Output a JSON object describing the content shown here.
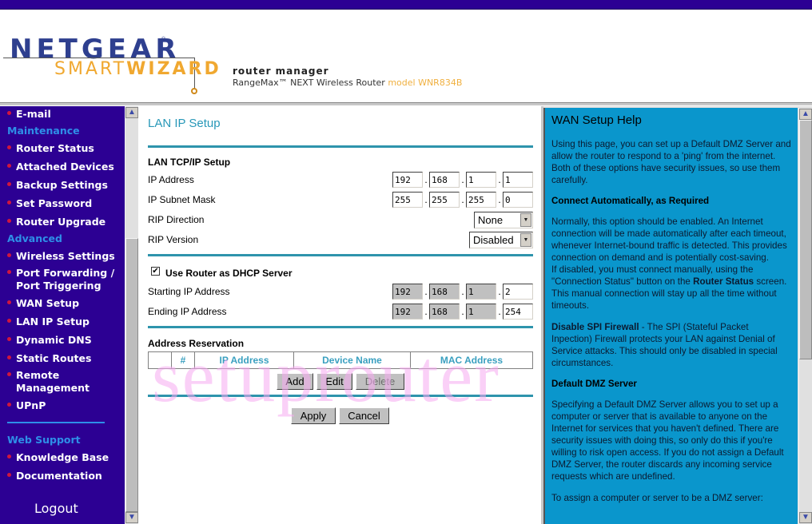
{
  "header": {
    "brand": "NETGEAR",
    "smart": "SMART",
    "wizard": "WIZARD",
    "router_manager": "router manager",
    "product": "RangeMax™ NEXT Wireless Router",
    "model": "model WNR834B"
  },
  "sidebar": {
    "items": [
      {
        "label": "E-mail",
        "type": "link"
      },
      {
        "label": "Maintenance",
        "type": "heading"
      },
      {
        "label": "Router Status",
        "type": "link"
      },
      {
        "label": "Attached Devices",
        "type": "link"
      },
      {
        "label": "Backup Settings",
        "type": "link"
      },
      {
        "label": "Set Password",
        "type": "link"
      },
      {
        "label": "Router Upgrade",
        "type": "link"
      },
      {
        "label": "Advanced",
        "type": "heading"
      },
      {
        "label": "Wireless Settings",
        "type": "link"
      },
      {
        "label": "Port Forwarding /",
        "label2": "Port Triggering",
        "type": "link"
      },
      {
        "label": "WAN Setup",
        "type": "link"
      },
      {
        "label": "LAN IP Setup",
        "type": "link"
      },
      {
        "label": "Dynamic DNS",
        "type": "link"
      },
      {
        "label": "Static Routes",
        "type": "link"
      },
      {
        "label": "Remote",
        "label2": "Management",
        "type": "link"
      },
      {
        "label": "UPnP",
        "type": "link"
      },
      {
        "label": "Web Support",
        "type": "heading"
      },
      {
        "label": "Knowledge Base",
        "type": "link"
      },
      {
        "label": "Documentation",
        "type": "link"
      }
    ],
    "logout": "Logout"
  },
  "main": {
    "title": "LAN IP Setup",
    "tcpip": {
      "heading": "LAN TCP/IP Setup",
      "ip_address": {
        "label": "IP Address",
        "octets": [
          "192",
          "168",
          "1",
          "1"
        ]
      },
      "subnet_mask": {
        "label": "IP Subnet Mask",
        "octets": [
          "255",
          "255",
          "255",
          "0"
        ]
      },
      "rip_direction": {
        "label": "RIP Direction",
        "value": "None"
      },
      "rip_version": {
        "label": "RIP Version",
        "value": "Disabled"
      }
    },
    "dhcp": {
      "checkbox_label": "Use Router as DHCP Server",
      "checked": true,
      "checkmark": "✔",
      "start": {
        "label": "Starting IP Address",
        "octets": [
          "192",
          "168",
          "1",
          "2"
        ]
      },
      "end": {
        "label": "Ending IP Address",
        "octets": [
          "192",
          "168",
          "1",
          "254"
        ]
      }
    },
    "reservation": {
      "heading": "Address Reservation",
      "columns": [
        "",
        "#",
        "IP Address",
        "Device Name",
        "MAC Address"
      ],
      "rows": [],
      "add": "Add",
      "edit": "Edit",
      "delete": "Delete"
    },
    "apply": "Apply",
    "cancel": "Cancel",
    "ip_separator": "."
  },
  "help": {
    "title": "WAN Setup Help",
    "intro": "Using this page, you can set up a Default DMZ Server and allow the router to respond to a 'ping' from the internet. Both of these options have security issues, so use them carefully.",
    "connect_heading": "Connect Automatically, as Required",
    "connect_p1": "Normally, this option should be enabled. An Internet connection will be made automatically after each timeout, whenever Internet-bound traffic is detected. This provides connection on demand and is potentially cost-saving.",
    "connect_p2a": "If disabled, you must connect manually, using the \"Connection Status\" button on the ",
    "connect_p2b": "Router Status",
    "connect_p2c": " screen. This manual connection will stay up all the time without timeouts.",
    "spi_heading": "Disable SPI Firewall",
    "spi_text": " - The SPI (Stateful Packet Inpection) Firewall protects your LAN against Denial of Service attacks. This should only be disabled in special circumstances.",
    "dmz_heading": "Default DMZ Server",
    "dmz_p1": "Specifying a Default DMZ Server allows you to set up a computer or server that is available to anyone on the Internet for services that you haven't defined. There are security issues with doing this, so only do this if you're willing to risk open access. If you do not assign a Default DMZ Server, the router discards any incoming service requests which are undefined.",
    "dmz_p2": "To assign a computer or server to be a DMZ server:"
  },
  "scroll_icons": {
    "up": "▲",
    "down": "▼",
    "select_arrow": "▼"
  },
  "watermark": "setuprouter",
  "colors": {
    "nav_bg": "#2c0093",
    "nav_heading": "#2e8fe8",
    "accent_teal": "#2e94ac",
    "help_bg": "#0a96cc",
    "bullet": "#d0163e"
  }
}
